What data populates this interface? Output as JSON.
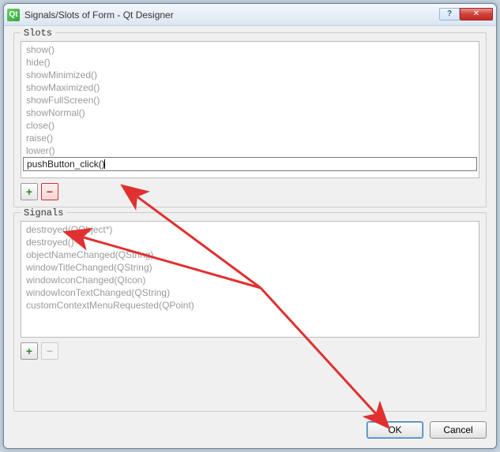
{
  "window": {
    "title": "Signals/Slots of Form - Qt Designer",
    "help_symbol": "?",
    "close_symbol": "✕"
  },
  "slots": {
    "label": "Slots",
    "items": [
      "show()",
      "hide()",
      "showMinimized()",
      "showMaximized()",
      "showFullScreen()",
      "showNormal()",
      "close()",
      "raise()",
      "lower()"
    ],
    "editing_value": "pushButton_click()",
    "add_symbol": "+",
    "remove_symbol": "−"
  },
  "signals": {
    "label": "Signals",
    "items": [
      "destroyed(QObject*)",
      "destroyed()",
      "objectNameChanged(QString)",
      "windowTitleChanged(QString)",
      "windowIconChanged(QIcon)",
      "windowIconTextChanged(QString)",
      "customContextMenuRequested(QPoint)"
    ],
    "add_symbol": "+",
    "remove_symbol": "−"
  },
  "buttons": {
    "ok": "OK",
    "cancel": "Cancel"
  }
}
